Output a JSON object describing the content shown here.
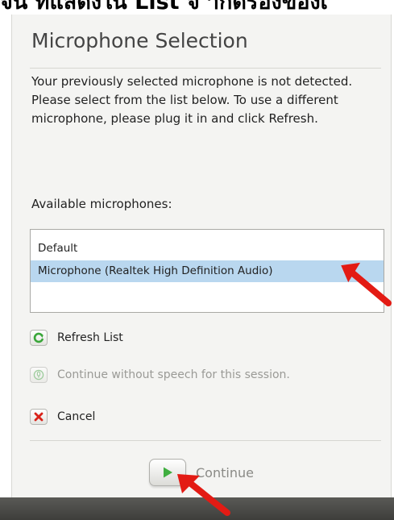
{
  "caption": {
    "text": "จน ที่แสดงใน List จ ำกัดร่องของเ"
  },
  "dialog": {
    "title": "Microphone Selection",
    "message": "Your previously selected microphone is not detected. Please select from the list below. To use a different microphone, please plug it in and click Refresh.",
    "available_label": "Available microphones:",
    "microphones": [
      {
        "label": "Default",
        "selected": false
      },
      {
        "label": "Microphone (Realtek High Definition Audio)",
        "selected": true
      }
    ],
    "actions": {
      "refresh": {
        "label": "Refresh List",
        "icon": "refresh-icon"
      },
      "no_speech": {
        "label": "Continue without speech for this session.",
        "icon": "microphone-off-icon",
        "enabled": false
      },
      "cancel": {
        "label": "Cancel",
        "icon": "cancel-x-icon"
      }
    },
    "continue": {
      "label": "Continue",
      "icon": "play-icon"
    }
  },
  "colors": {
    "selection": "#b9d7ef",
    "annotation_arrow": "#e31b14",
    "green_icon": "#3aa63a",
    "cancel_red": "#d9221a"
  }
}
